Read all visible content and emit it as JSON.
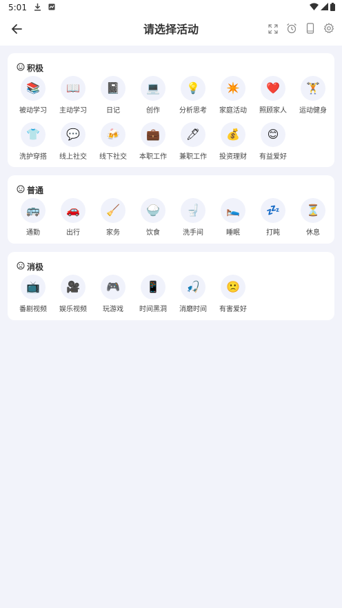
{
  "status_bar": {
    "time": "5:01"
  },
  "app_bar": {
    "title": "请选择活动"
  },
  "colors": {
    "page_bg": "#f2f3fa",
    "card_bg": "#ffffff",
    "icon_circle_bg": "#f0f2fb",
    "text": "#444444"
  },
  "sections": [
    {
      "title": "积极",
      "items": [
        {
          "label": "被动学习",
          "icon": "📚",
          "icon_name": "books-icon"
        },
        {
          "label": "主动学习",
          "icon": "📖",
          "icon_name": "open-book-icon"
        },
        {
          "label": "日记",
          "icon": "📓",
          "icon_name": "notebook-icon"
        },
        {
          "label": "创作",
          "icon": "💻",
          "icon_name": "laptop-icon"
        },
        {
          "label": "分析思考",
          "icon": "💡",
          "icon_name": "light-bulb-icon"
        },
        {
          "label": "家庭活动",
          "icon": "✴️",
          "icon_name": "sparkle-icon"
        },
        {
          "label": "照顾家人",
          "icon": "❤️",
          "icon_name": "heart-icon"
        },
        {
          "label": "运动健身",
          "icon": "🏋",
          "icon_name": "weightlifter-icon"
        },
        {
          "label": "洗护穿搭",
          "icon": "👕",
          "icon_name": "tshirt-icon"
        },
        {
          "label": "线上社交",
          "icon": "💬",
          "icon_name": "speech-bubble-icon"
        },
        {
          "label": "线下社交",
          "icon": "🍻",
          "icon_name": "beer-mugs-icon"
        },
        {
          "label": "本职工作",
          "icon": "💼",
          "icon_name": "briefcase-icon"
        },
        {
          "label": "兼职工作",
          "icon": "🖊",
          "icon_name": "pen-icon"
        },
        {
          "label": "投资理财",
          "icon": "💰",
          "icon_name": "money-bag-icon"
        },
        {
          "label": "有益爱好",
          "icon": "😊",
          "icon_name": "smiling-face-icon"
        }
      ]
    },
    {
      "title": "普通",
      "items": [
        {
          "label": "通勤",
          "icon": "🚌",
          "icon_name": "bus-icon"
        },
        {
          "label": "出行",
          "icon": "🚗",
          "icon_name": "car-icon"
        },
        {
          "label": "家务",
          "icon": "🧹",
          "icon_name": "broom-icon"
        },
        {
          "label": "饮食",
          "icon": "🍚",
          "icon_name": "rice-bowl-icon"
        },
        {
          "label": "洗手间",
          "icon": "🚽",
          "icon_name": "toilet-icon"
        },
        {
          "label": "睡眠",
          "icon": "🛌",
          "icon_name": "bed-icon"
        },
        {
          "label": "打盹",
          "icon": "💤",
          "icon_name": "zzz-icon"
        },
        {
          "label": "休息",
          "icon": "⏳",
          "icon_name": "hourglass-icon"
        }
      ]
    },
    {
      "title": "消极",
      "items": [
        {
          "label": "番剧视频",
          "icon": "📺",
          "icon_name": "television-icon"
        },
        {
          "label": "娱乐视频",
          "icon": "🎥",
          "icon_name": "movie-camera-icon"
        },
        {
          "label": "玩游戏",
          "icon": "🎮",
          "icon_name": "game-controller-icon"
        },
        {
          "label": "时间黑洞",
          "icon": "📱",
          "icon_name": "mobile-phone-icon"
        },
        {
          "label": "消磨时间",
          "icon": "🎣",
          "icon_name": "fishing-rod-icon"
        },
        {
          "label": "有害爱好",
          "icon": "🙁",
          "icon_name": "frowning-face-icon"
        }
      ]
    }
  ]
}
